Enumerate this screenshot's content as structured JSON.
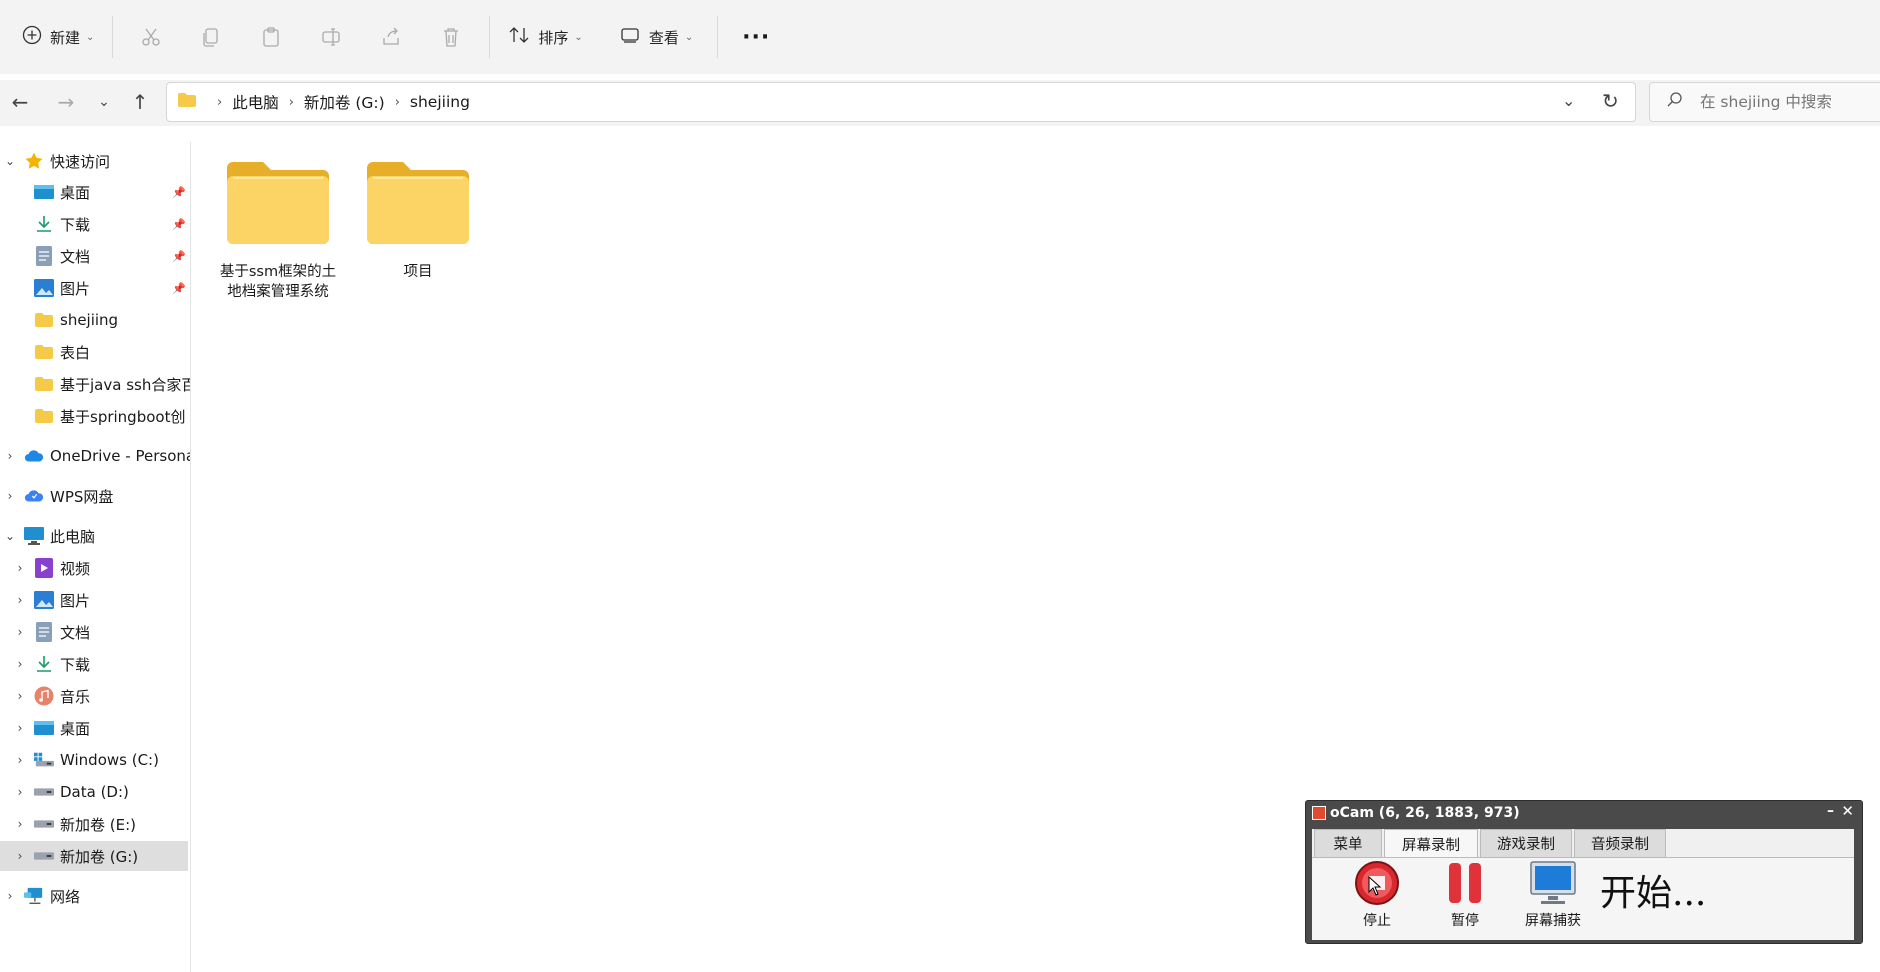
{
  "toolbar": {
    "new_label": "新建",
    "sort_label": "排序",
    "view_label": "查看"
  },
  "address": {
    "crumbs": [
      "此电脑",
      "新加卷 (G:)",
      "shejiing"
    ]
  },
  "search": {
    "placeholder": "在 shejiing 中搜索"
  },
  "sidebar": {
    "quick_access": "快速访问",
    "quick_items": [
      {
        "label": "桌面",
        "icon": "desktop-icon",
        "pinned": true
      },
      {
        "label": "下载",
        "icon": "download-icon",
        "pinned": true
      },
      {
        "label": "文档",
        "icon": "document-icon",
        "pinned": true
      },
      {
        "label": "图片",
        "icon": "picture-icon",
        "pinned": true
      },
      {
        "label": "shejiing",
        "icon": "folder-icon",
        "pinned": false
      },
      {
        "label": "表白",
        "icon": "folder-icon",
        "pinned": false
      },
      {
        "label": "基于java ssh合家百",
        "icon": "folder-icon",
        "pinned": false
      },
      {
        "label": "基于springboot创",
        "icon": "folder-icon",
        "pinned": false
      }
    ],
    "onedrive": "OneDrive - Persona",
    "wps": "WPS网盘",
    "this_pc": "此电脑",
    "pc_items": [
      {
        "label": "视频",
        "icon": "video-icon"
      },
      {
        "label": "图片",
        "icon": "picture-icon"
      },
      {
        "label": "文档",
        "icon": "document-icon"
      },
      {
        "label": "下载",
        "icon": "download-icon"
      },
      {
        "label": "音乐",
        "icon": "music-icon"
      },
      {
        "label": "桌面",
        "icon": "desktop-icon"
      },
      {
        "label": "Windows (C:)",
        "icon": "windows-drive-icon"
      },
      {
        "label": "Data (D:)",
        "icon": "drive-icon"
      },
      {
        "label": "新加卷 (E:)",
        "icon": "drive-icon"
      },
      {
        "label": "新加卷 (G:)",
        "icon": "drive-icon",
        "selected": true
      }
    ],
    "network": "网络"
  },
  "content": {
    "items": [
      {
        "name": "基于ssm框架的土地档案管理系统",
        "type": "folder"
      },
      {
        "name": "项目",
        "type": "folder"
      }
    ]
  },
  "ocam": {
    "title": "oCam (6, 26, 1883, 973)",
    "tabs": [
      "菜单",
      "屏幕录制",
      "游戏录制",
      "音频录制"
    ],
    "active_tab": "屏幕录制",
    "stop_label": "停止",
    "pause_label": "暂停",
    "capture_label": "屏幕捕获",
    "status": "开始..."
  },
  "colors": {
    "folder": "#f7c948",
    "accent": "#0067c0",
    "toolbar_bg": "#f3f3f3",
    "ocam_record": "#d9272e"
  }
}
